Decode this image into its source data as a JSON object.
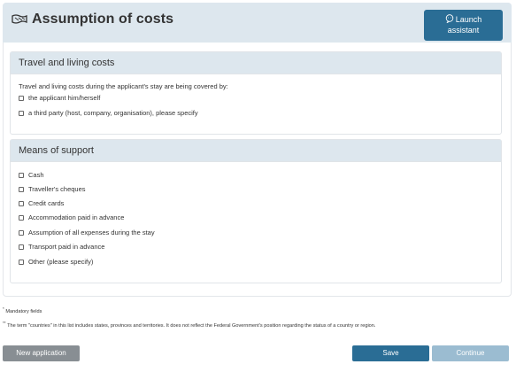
{
  "header": {
    "title": "Assumption of costs",
    "assistant_line1": "Launch",
    "assistant_line2": "assistant"
  },
  "travel_section": {
    "heading": "Travel and living costs",
    "intro": "Travel and living costs during the applicant's stay are being covered by:",
    "options": [
      "the applicant him/herself",
      "a third party (host, company, organisation), please specify"
    ]
  },
  "support_section": {
    "heading": "Means of support",
    "options": [
      "Cash",
      "Traveller's cheques",
      "Credit cards",
      "Accommodation paid in advance",
      "Assumption of all expenses during the stay",
      "Transport paid in advance",
      "Other (please specify)"
    ]
  },
  "notes": {
    "mandatory_marker": "*",
    "mandatory": "Mandatory fields",
    "countries_marker": "**",
    "countries": "The term \"countries\" in this list includes states, provinces and territories. It does not reflect the Federal Government's position regarding the status of a country or region."
  },
  "footer": {
    "new_application": "New application",
    "save": "Save",
    "continue": "Continue"
  },
  "colors": {
    "header_bg": "#dde7ee",
    "primary": "#2a6d95",
    "disabled_primary": "#9bbcd1",
    "secondary": "#888e93"
  },
  "icons": {
    "title": "flag-logo-icon",
    "assistant": "chat-bubble-icon",
    "checkbox": "checkbox-unchecked-icon"
  }
}
